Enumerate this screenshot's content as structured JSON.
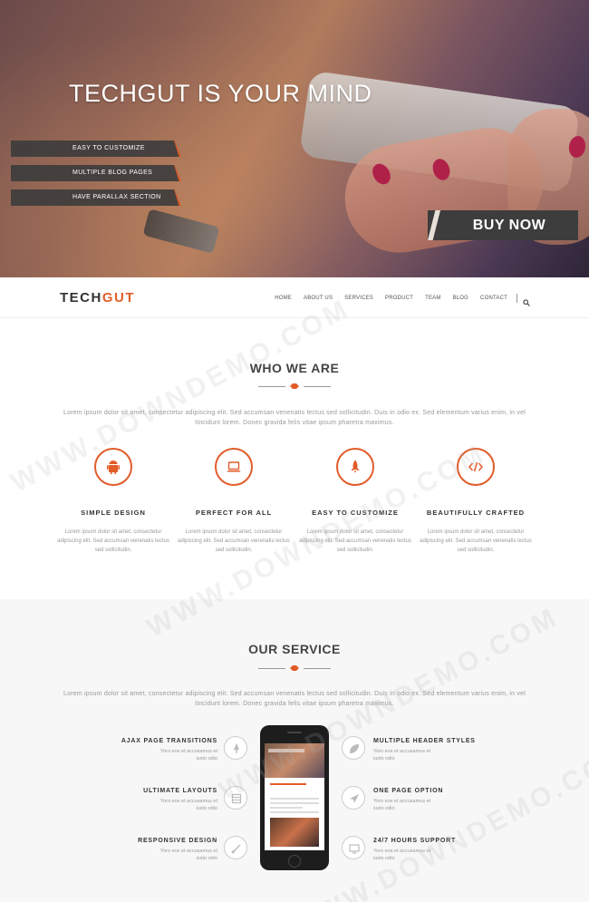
{
  "hero": {
    "title": "TECHGUT IS YOUR MIND",
    "tags": [
      "EASY TO CUSTOMIZE",
      "MULTIPLE BLOG PAGES",
      "HAVE PARALLAX SECTION"
    ],
    "buy_label": "BUY NOW"
  },
  "nav": {
    "logo_main": "TECH",
    "logo_accent": "GUT",
    "items": [
      "HOME",
      "ABOUT US",
      "SERVICES",
      "PRODUCT",
      "TEAM",
      "BLOG",
      "CONTACT"
    ]
  },
  "who": {
    "title": "WHO WE ARE",
    "desc": "Lorem ipsum dolor sit amet, consectetur adipiscing elit. Sed accumsan venenatis lectus sed sollicitudin. Duis in odio ex. Sed elementum varius enim, in vel tincidunt lorem. Donec gravida felis vitae ipsum pharetra maximus.",
    "features": [
      {
        "title": "SIMPLE DESIGN",
        "text": "Lorem ipsum dolor sit amet, consectetur adipiscing elit. Sed accumsan venenatis lectus sed sollicitudin.",
        "icon": "android-icon"
      },
      {
        "title": "PERFECT FOR ALL",
        "text": "Lorem ipsum dolor sit amet, consectetur adipiscing elit. Sed accumsan venenatis lectus sed sollicitudin.",
        "icon": "laptop-icon"
      },
      {
        "title": "EASY TO CUSTOMIZE",
        "text": "Lorem ipsum dolor sit amet, consectetur adipiscing elit. Sed accumsan venenatis lectus sed sollicitudin.",
        "icon": "rocket-icon"
      },
      {
        "title": "BEAUTIFULLY CRAFTED",
        "text": "Lorem ipsum dolor sit amet, consectetur adipiscing elit. Sed accumsan venenatis lectus sed sollicitudin.",
        "icon": "code-icon"
      }
    ]
  },
  "service": {
    "title": "OUR SERVICE",
    "desc": "Lorem ipsum dolor sit amet, consectetur adipiscing elit. Sed accumsan venenatis lectus sed sollicitudin. Duis in odio ex. Sed elementum varius enim, in vel tincidunt lorem. Donec gravida felis vitae ipsum pharetra maximus.",
    "left": [
      {
        "title": "AJAX PAGE TRANSITIONS",
        "text": "Yoro eos et accusamus et iusto odio",
        "icon": "tree-icon"
      },
      {
        "title": "ULTIMATE LAYOUTS",
        "text": "Yoro eos et accusamus et iusto odio",
        "icon": "layers-icon"
      },
      {
        "title": "RESPONSIVE DESIGN",
        "text": "Yoro eos et accusamus et iusto odio",
        "icon": "brush-icon"
      }
    ],
    "right": [
      {
        "title": "MULTIPLE HEADER STYLES",
        "text": "Yoro eos et accusamus et iusto odio",
        "icon": "leaf-icon"
      },
      {
        "title": "ONE PAGE OPTION",
        "text": "Yoro eos et accusamus et iusto odio",
        "icon": "plane-icon"
      },
      {
        "title": "24/7 HOURS SUPPORT",
        "text": "Yoro eos et accusamus et iusto odio",
        "icon": "monitor-icon"
      }
    ]
  },
  "watermark": "WWW.DOWNDEMO.COM",
  "colors": {
    "accent": "#e25c2a",
    "dark": "#3d3d3d"
  }
}
